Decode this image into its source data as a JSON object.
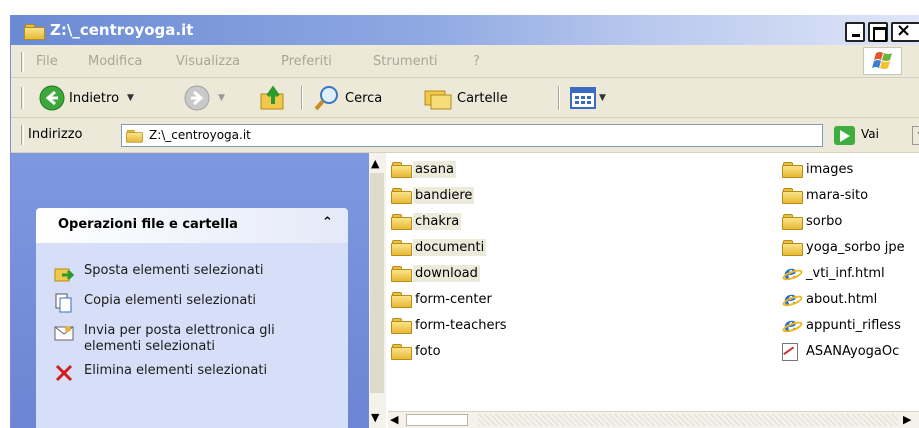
{
  "window": {
    "title": "Z:\\_centroyoga.it"
  },
  "menu": [
    "File",
    "Modifica",
    "Visualizza",
    "Preferiti",
    "Strumenti",
    "?"
  ],
  "toolbar": {
    "back_label": "Indietro",
    "search_label": "Cerca",
    "folders_label": "Cartelle"
  },
  "address": {
    "label": "Indirizzo",
    "value": "Z:\\_centroyoga.it",
    "go_label": "Vai"
  },
  "taskpane": {
    "title": "Operazioni file e cartella",
    "tasks": [
      "Sposta elementi selezionati",
      "Copia elementi selezionati",
      "Invia per posta elettronica gli elementi selezionati",
      "Elimina elementi selezionati"
    ]
  },
  "files": {
    "column1": [
      {
        "name": "asana",
        "type": "folder",
        "selected": true
      },
      {
        "name": "bandiere",
        "type": "folder",
        "selected": true
      },
      {
        "name": "chakra",
        "type": "folder",
        "selected": true
      },
      {
        "name": "documenti",
        "type": "folder",
        "selected": true
      },
      {
        "name": "download",
        "type": "folder",
        "selected": true
      },
      {
        "name": "form-center",
        "type": "folder",
        "selected": false
      },
      {
        "name": "form-teachers",
        "type": "folder",
        "selected": false
      },
      {
        "name": "foto",
        "type": "folder",
        "selected": false
      }
    ],
    "column2": [
      {
        "name": "images",
        "type": "folder"
      },
      {
        "name": "mara-sito",
        "type": "folder"
      },
      {
        "name": "sorbo",
        "type": "folder"
      },
      {
        "name": "yoga_sorbo jpe",
        "type": "folder"
      },
      {
        "name": "_vti_inf.html",
        "type": "html"
      },
      {
        "name": "about.html",
        "type": "html"
      },
      {
        "name": "appunti_rifless",
        "type": "html"
      },
      {
        "name": "ASANAyogaOc",
        "type": "doc"
      }
    ]
  },
  "colors": {
    "titlebar_start": "#6a8ad4",
    "taskpane_body": "#d6dff7",
    "chrome": "#ece9d8"
  }
}
